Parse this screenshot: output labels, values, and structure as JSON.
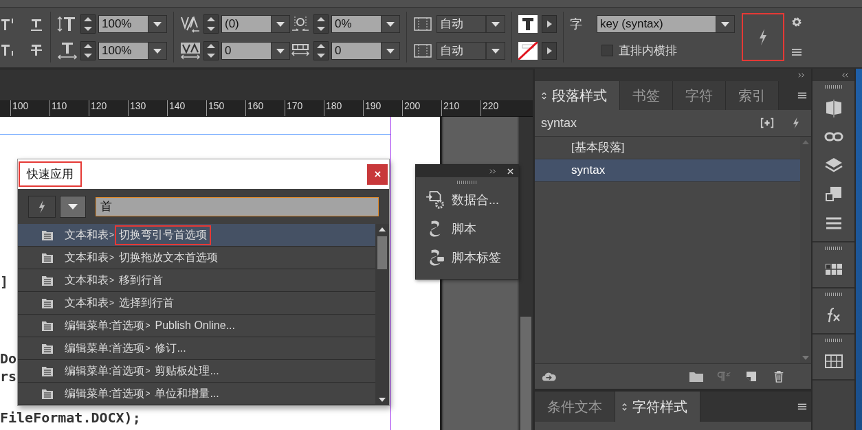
{
  "control_bar": {
    "field_groups": [
      [
        {
          "kind": "vertical-scale",
          "value": "100%"
        },
        {
          "kind": "horizontal-scale",
          "value": "100%"
        }
      ],
      [
        {
          "kind": "kerning",
          "value": "(0)"
        },
        {
          "kind": "tracking",
          "value": "0"
        }
      ],
      [
        {
          "kind": "tsume",
          "value": "0%"
        },
        {
          "kind": "grid-spacing",
          "value": "0"
        }
      ],
      [
        {
          "kind": "aki-before",
          "value": "自动"
        },
        {
          "kind": "aki-after",
          "value": "自动"
        }
      ]
    ],
    "character_style": {
      "label": "字",
      "value": "key (syntax)"
    },
    "tate_chu_yoko": {
      "label": "直排内横排",
      "checked": false
    },
    "quick_apply_button": {
      "highlighted": true
    }
  },
  "ruler": {
    "labels": [
      "100",
      "110",
      "120",
      "130",
      "140",
      "150",
      "160",
      "170",
      "180",
      "190",
      "200",
      "210",
      "220"
    ]
  },
  "document": {
    "code_lines": [
      {
        "text": "]"
      },
      {
        "text": "Do"
      },
      {
        "text": "rs"
      },
      {
        "text": "FileFormat.DOCX);"
      }
    ]
  },
  "quick_apply": {
    "title": "快速应用",
    "title_highlighted": true,
    "query": "首",
    "items": [
      {
        "path": "文本和表",
        "command": "切换弯引号首选项",
        "selected": true,
        "highlighted": true
      },
      {
        "path": "文本和表",
        "command": "切换拖放文本首选项",
        "selected": false,
        "highlighted": false
      },
      {
        "path": "文本和表",
        "command": "移到行首",
        "selected": false,
        "highlighted": false
      },
      {
        "path": "文本和表",
        "command": "选择到行首",
        "selected": false,
        "highlighted": false
      },
      {
        "path": "编辑菜单:首选项",
        "command": "Publish Online...",
        "selected": false,
        "highlighted": false
      },
      {
        "path": "编辑菜单:首选项",
        "command": "修订...",
        "selected": false,
        "highlighted": false
      },
      {
        "path": "编辑菜单:首选项",
        "command": "剪贴板处理...",
        "selected": false,
        "highlighted": false
      },
      {
        "path": "编辑菜单:首选项",
        "command": "单位和增量...",
        "selected": false,
        "highlighted": false
      }
    ],
    "separator": ">"
  },
  "scripts_panel": {
    "items": [
      {
        "kind": "data-merge",
        "label": "数据合..."
      },
      {
        "kind": "scripts",
        "label": "脚本"
      },
      {
        "kind": "script-label",
        "label": "脚本标签"
      }
    ]
  },
  "paragraph_styles_panel": {
    "tabs": [
      {
        "label": "段落样式",
        "selected": true
      },
      {
        "label": "书签",
        "selected": false
      },
      {
        "label": "字符",
        "selected": false
      },
      {
        "label": "索引",
        "selected": false
      }
    ],
    "current_style": "syntax",
    "styles": [
      {
        "name": "[基本段落]",
        "selected": false
      },
      {
        "name": "syntax",
        "selected": true
      }
    ]
  },
  "character_styles_panel": {
    "tabs": [
      {
        "label": "条件文本",
        "selected": false
      },
      {
        "label": "字符样式",
        "selected": true
      }
    ]
  }
}
